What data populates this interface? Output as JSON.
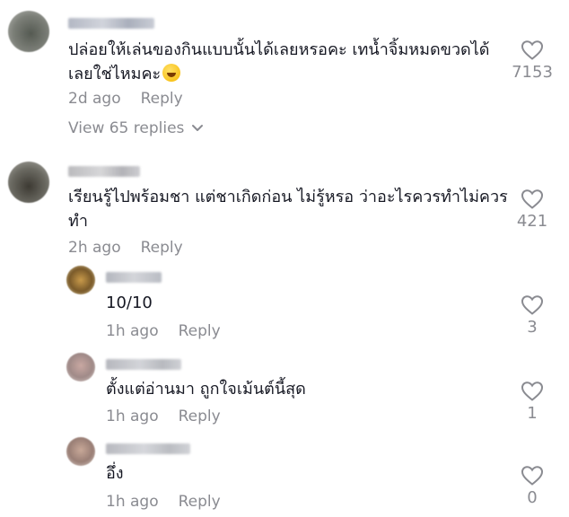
{
  "comments": [
    {
      "text": "ปล่อยให้เล่นของกินแบบนั้นได้เลยหรอคะ เทน้ำจิ้มหมดขวดได้เลยใช่ไหมคะ",
      "time": "2d ago",
      "reply_label": "Reply",
      "likes": "7153",
      "view_replies": "View 65 replies",
      "emoji": "grinning-sweat-emoji"
    },
    {
      "text": "เรียนรู้ไปพร้อมชา แต่ชาเกิดก่อน ไม่รู้หรอ ว่าอะไรควรทำไม่ควรทำ",
      "time": "2h ago",
      "reply_label": "Reply",
      "likes": "421"
    }
  ],
  "replies": [
    {
      "text": "10/10",
      "time": "1h ago",
      "reply_label": "Reply",
      "likes": "3"
    },
    {
      "text": "ตั้งแต่อ่านมา ถูกใจเม้นต์นี้สุด",
      "time": "1h ago",
      "reply_label": "Reply",
      "likes": "1"
    },
    {
      "text": "อึ่ง",
      "time": "1h ago",
      "reply_label": "Reply",
      "likes": "0"
    }
  ],
  "colors": {
    "text": "#161823",
    "meta": "#8a8b91",
    "background": "#ffffff"
  },
  "icons": [
    "heart-outline-icon",
    "chevron-down-icon"
  ]
}
